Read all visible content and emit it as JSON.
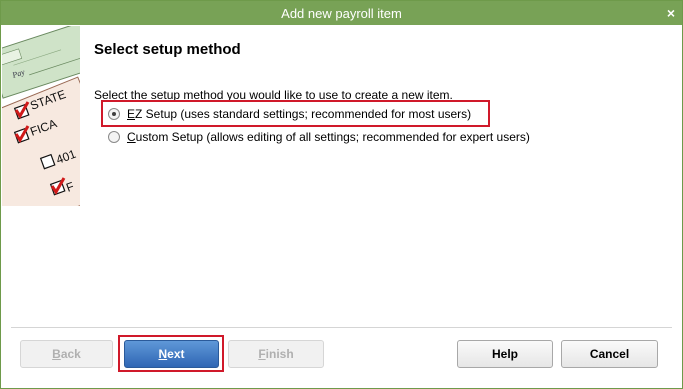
{
  "window": {
    "title": "Add new payroll item",
    "close_glyph": "×"
  },
  "art": {
    "pay_label": "Pay",
    "items": [
      "STATE",
      "FICA",
      "401",
      "F"
    ]
  },
  "heading": "Select setup method",
  "prompt": "Select the setup method you would like to use to create a new item.",
  "options": [
    {
      "mnemonic": "E",
      "rest": "Z Setup (uses standard settings; recommended for most users)",
      "selected": true
    },
    {
      "mnemonic": "C",
      "rest": "ustom Setup (allows editing of all settings; recommended for expert users)",
      "selected": false
    }
  ],
  "buttons": {
    "back": {
      "mnemonic": "B",
      "rest": "ack"
    },
    "next": {
      "mnemonic": "N",
      "rest": "ext"
    },
    "finish": {
      "mnemonic": "F",
      "rest": "inish"
    },
    "help": "Help",
    "cancel": "Cancel"
  },
  "colors": {
    "titlebar": "#78a256",
    "highlight": "#d0192a",
    "primary_button": "#3a72c0"
  }
}
